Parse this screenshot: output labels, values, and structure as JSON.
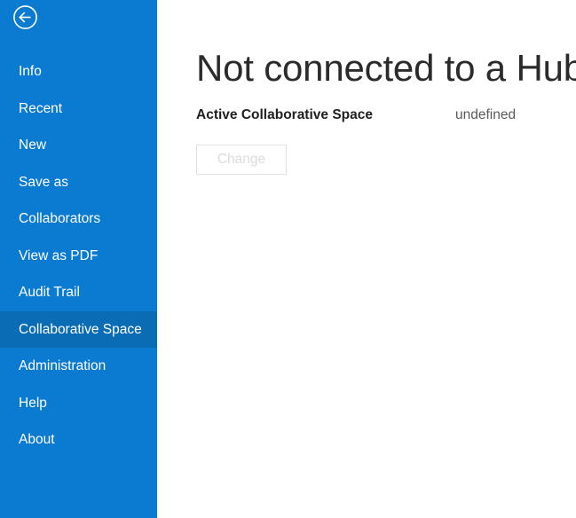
{
  "sidebar": {
    "back_icon": "back-arrow-circle-icon",
    "accent_color": "#0b7ad1",
    "selected_color": "#0a6cb4",
    "items": [
      {
        "label": "Info",
        "selected": false
      },
      {
        "label": "Recent",
        "selected": false
      },
      {
        "label": "New",
        "selected": false
      },
      {
        "label": "Save as",
        "selected": false
      },
      {
        "label": "Collaborators",
        "selected": false
      },
      {
        "label": "View as PDF",
        "selected": false
      },
      {
        "label": "Audit Trail",
        "selected": false
      },
      {
        "label": "Collaborative Space",
        "selected": true
      },
      {
        "label": "Administration",
        "selected": false
      },
      {
        "label": "Help",
        "selected": false
      },
      {
        "label": "About",
        "selected": false
      }
    ]
  },
  "main": {
    "title": "Not connected to a Hub",
    "field": {
      "label": "Active Collaborative Space",
      "value": "undefined"
    },
    "change_button": {
      "label": "Change",
      "disabled": true
    }
  }
}
